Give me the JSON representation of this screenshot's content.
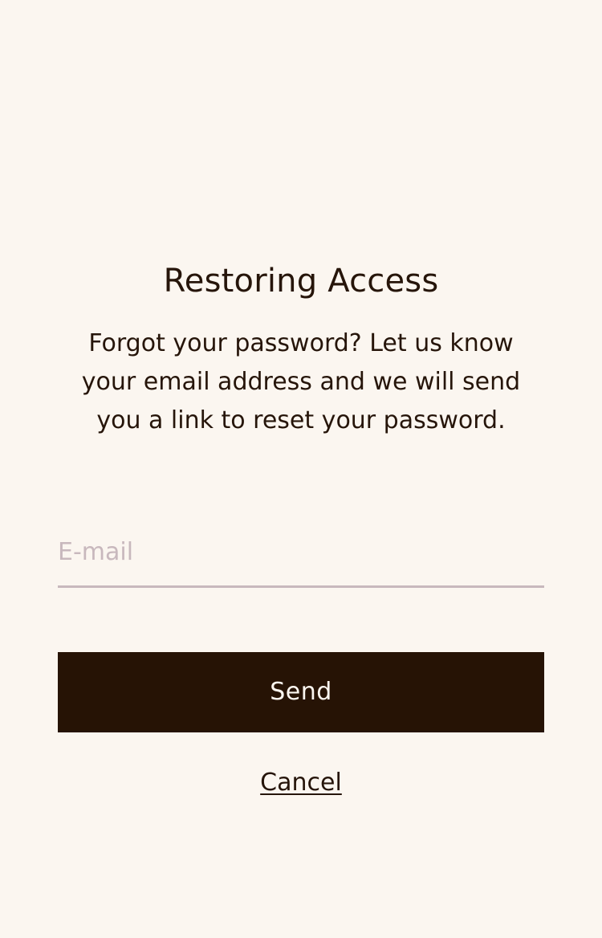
{
  "page": {
    "title": "Restoring Access",
    "description": "Forgot your password? Let us know your email address and we will send you a link to reset your password."
  },
  "form": {
    "email": {
      "placeholder": "E-mail",
      "value": ""
    },
    "send_label": "Send",
    "cancel_label": "Cancel"
  },
  "colors": {
    "background": "#fbf6f0",
    "text": "#26150a",
    "button_background": "#261305",
    "button_text": "#fbf6f0",
    "input_underline": "#c8b8bd",
    "placeholder": "#c8b8bd"
  }
}
